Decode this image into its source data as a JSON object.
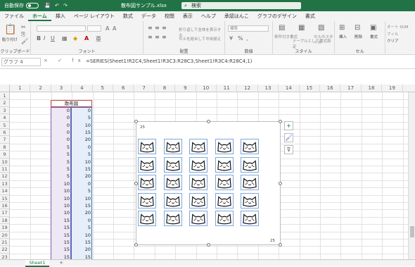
{
  "titlebar": {
    "autosave_label": "自動保存",
    "autosave_state": "オフ",
    "qa_icons": "💾 ↶ ↷",
    "doc_title": "散布図サンプル.xlsx",
    "search_placeholder": "検索"
  },
  "tabs": [
    "ファイル",
    "ホーム",
    "挿入",
    "ページ レイアウト",
    "数式",
    "データ",
    "校閲",
    "表示",
    "ヘルプ",
    "承認はんこ",
    "グラフのデザイン",
    "書式"
  ],
  "active_tab": "ホーム",
  "ribbon": {
    "paste_label": "貼り付け",
    "clipboard_label": "クリップボード",
    "font_label": "フォント",
    "align_label": "配置",
    "number_label": "数値",
    "style_label": "スタイル",
    "cells_label": "セル",
    "wrap_text": "折り返して全体を表示する",
    "merge_center": "セルを結合して中央揃え",
    "number_format": "標準",
    "cond_format": "条件付き書式",
    "table_format": "テーブルとして書式設定",
    "cell_style": "セルのスタイル",
    "insert": "挿入",
    "delete": "削除",
    "format": "書式",
    "autosum": "オート SUM",
    "fill": "フィル",
    "clear": "クリア"
  },
  "formulabar": {
    "name_box": "グラフ 4",
    "buttons": "× ✓ fx",
    "formula": "=SERIES(Sheet1!R2C4,Sheet1!R3C3:R28C3,Sheet1!R3C4:R28C4,1)"
  },
  "columns": [
    "1",
    "2",
    "3",
    "4",
    "5",
    "6",
    "7",
    "8",
    "9",
    "10",
    "11",
    "12",
    "13",
    "14",
    "15",
    "16",
    "17",
    "18",
    "19"
  ],
  "rows": [
    "1",
    "2",
    "3",
    "4",
    "5",
    "6",
    "7",
    "8",
    "9",
    "10",
    "11",
    "12",
    "13",
    "14",
    "15",
    "16",
    "17",
    "18",
    "19",
    "20",
    "21",
    "22",
    "23"
  ],
  "table": {
    "header": "散布図",
    "col3": [
      "0",
      "0",
      "0",
      "0",
      "0",
      "5",
      "5",
      "5",
      "5",
      "5",
      "10",
      "10",
      "10",
      "10",
      "10",
      "15",
      "15",
      "15",
      "15",
      "15",
      "15"
    ],
    "col4": [
      "0",
      "5",
      "10",
      "15",
      "20",
      "0",
      "5",
      "10",
      "15",
      "20",
      "0",
      "5",
      "10",
      "15",
      "20",
      "0",
      "5",
      "10",
      "15",
      "20",
      "15"
    ]
  },
  "chart_labels": {
    "y_top": "25",
    "x_right": "25"
  },
  "chart_data": {
    "type": "scatter",
    "x": [
      0,
      0,
      0,
      0,
      0,
      5,
      5,
      5,
      5,
      5,
      10,
      10,
      10,
      10,
      10,
      15,
      15,
      15,
      15,
      15,
      20,
      20,
      20,
      20,
      20
    ],
    "y": [
      0,
      5,
      10,
      15,
      20,
      0,
      5,
      10,
      15,
      20,
      0,
      5,
      10,
      15,
      20,
      0,
      5,
      10,
      15,
      20,
      0,
      5,
      10,
      15,
      20
    ],
    "xlim": [
      0,
      25
    ],
    "ylim": [
      0,
      25
    ],
    "marker": "cat-icon"
  },
  "sidebuttons": {
    "add": "+",
    "brush": "🖌",
    "filter": "⊽"
  },
  "status": {
    "sheet_tab": "Sheet1",
    "add_sheet": "+"
  }
}
